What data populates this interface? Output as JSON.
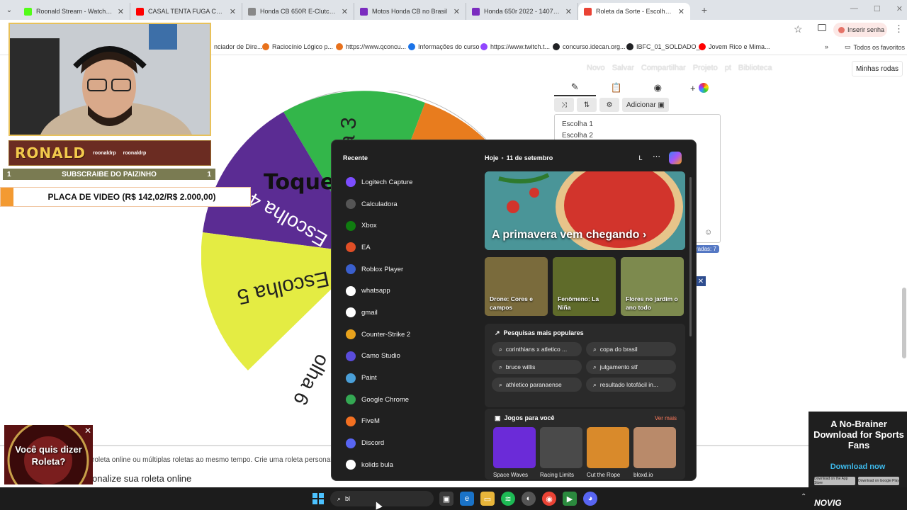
{
  "browser": {
    "tabs": [
      {
        "title": "Roonald Stream - Watch Live o",
        "color": "#53fc18",
        "active": false
      },
      {
        "title": "CASAL TENTA FUGA COM MOT",
        "color": "#ff0000",
        "active": false
      },
      {
        "title": "Honda CB 650R E-Clutch | Est",
        "color": "#888888",
        "active": false
      },
      {
        "title": "Motos Honda CB no Brasil",
        "color": "#7b2cbf",
        "active": false
      },
      {
        "title": "Honda 650r 2022 - 140713551",
        "color": "#7b2cbf",
        "active": false
      },
      {
        "title": "Roleta da Sorte - Escolha Pers",
        "color": "#ea4335",
        "active": true
      }
    ],
    "new_tab": "+",
    "password_button": "Inserir senha",
    "bookmarks": [
      {
        "label": "nciador de Dire...",
        "color": "#888888"
      },
      {
        "label": "Raciocínio Lógico p...",
        "color": "#e8711c"
      },
      {
        "label": "https://www.qconcu...",
        "color": "#e8711c"
      },
      {
        "label": "Informações do curso",
        "color": "#1a73e8"
      },
      {
        "label": "https://www.twitch.t...",
        "color": "#9146ff"
      },
      {
        "label": "concurso.idecan.org...",
        "color": "#202124"
      },
      {
        "label": "IBFC_01_SOLDADO_...",
        "color": "#202124"
      },
      {
        "label": "Jovem Rico e Mima...",
        "color": "#ff0000"
      }
    ],
    "all_bookmarks": "Todos os favoritos"
  },
  "site": {
    "actions": [
      "Novo",
      "Salvar",
      "Compartilhar",
      "Projeto",
      "pt",
      "Biblioteca"
    ],
    "my_wheels": "Minhas rodas",
    "add_button": "Adicionar",
    "choices": [
      "Escolha 1",
      "Escolha 2"
    ],
    "entries_tag": "radas: 7",
    "wheel_center": "Toque",
    "wheel_labels": [
      "a 3",
      "Escolha 4",
      "Escolha 5",
      "olha 6"
    ],
    "bottom_text": "roleta online ou múltiplas roletas ao mesmo tempo. Crie uma roleta personalizad",
    "bottom_heading": "onalize sua roleta online"
  },
  "overlay": {
    "banner_logo": "RONALD",
    "banner_handle": "roonaldrp",
    "sub_left": "1",
    "sub_text": "SUBSCRAIBE DO PAIZINHO",
    "sub_right": "1",
    "goal_text": "PLACA DE VIDEO (R$ 142,02/R$ 2.000,00)",
    "roleta_ad_q": "Você quis dizer Roleta?",
    "right_ad_headline": "A No-Brainer Download for Sports Fans",
    "right_ad_cta": "Download now",
    "right_ad_store1": "Download on the App Store",
    "right_ad_store2": "Download on Google Play"
  },
  "start_menu": {
    "recent_title": "Recente",
    "apps": [
      {
        "label": "Logitech Capture",
        "color": "#7c4dff"
      },
      {
        "label": "Calculadora",
        "color": "#555555"
      },
      {
        "label": "Xbox",
        "color": "#107c10"
      },
      {
        "label": "EA",
        "color": "#e04e26"
      },
      {
        "label": "Roblox Player",
        "color": "#3a5fcd"
      },
      {
        "label": "whatsapp",
        "color": "#ffffff"
      },
      {
        "label": "gmail",
        "color": "#ffffff"
      },
      {
        "label": "Counter-Strike 2",
        "color": "#e8a21c"
      },
      {
        "label": "Camo Studio",
        "color": "#5a4cdb"
      },
      {
        "label": "Paint",
        "color": "#4a9fd8"
      },
      {
        "label": "Google Chrome",
        "color": "#34a853"
      },
      {
        "label": "FiveM",
        "color": "#f37021"
      },
      {
        "label": "Discord",
        "color": "#5865f2"
      },
      {
        "label": "kolids bula",
        "color": "#ffffff"
      }
    ],
    "today": "Hoje",
    "date": "11 de setembro",
    "profile_initial": "L",
    "hero_caption": "A primavera vem chegando",
    "thumbs": [
      {
        "caption": "Drone: Cores e campos",
        "color": "#7a6b3c"
      },
      {
        "caption": "Fenômeno: La Niña",
        "color": "#5f6b2a"
      },
      {
        "caption": "Flores no jardim o ano todo",
        "color": "#7d8a4e"
      }
    ],
    "popular_title": "Pesquisas mais populares",
    "popular": [
      "corinthians x atletico ...",
      "copa do brasil",
      "bruce willis",
      "julgamento stf",
      "athletico paranaense",
      "resultado lotofácil in..."
    ],
    "games_title": "Jogos para você",
    "see_more": "Ver mais",
    "games": [
      {
        "name": "Space Waves",
        "color": "#6b2bd8"
      },
      {
        "name": "Racing Limits",
        "color": "#4a4a4a"
      },
      {
        "name": "Cut the Rope",
        "color": "#d98a2b"
      },
      {
        "name": "bloxd.io",
        "color": "#b98a6a"
      }
    ]
  },
  "taskbar": {
    "search_value": "bl",
    "brand": "NOVIG"
  }
}
